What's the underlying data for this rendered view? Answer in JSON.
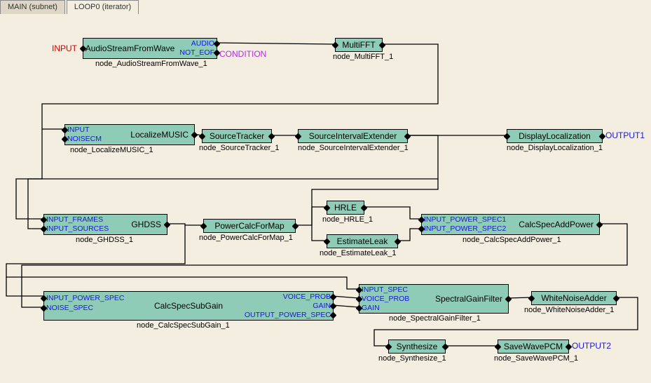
{
  "tabs": [
    {
      "label": "MAIN (subnet)"
    },
    {
      "label": "LOOP0 (iterator)",
      "active": true
    }
  ],
  "tags": {
    "input": "INPUT",
    "condition": "CONDITION",
    "output1": "OUTPUT1",
    "output2": "OUTPUT2"
  },
  "nodes": {
    "audio": {
      "title": "AudioStreamFromWave",
      "inst": "node_AudioStreamFromWave_1",
      "out1": "AUDIO",
      "out2": "NOT_EOF"
    },
    "mfft": {
      "title": "MultiFFT",
      "inst": "node_MultiFFT_1"
    },
    "loc": {
      "title": "LocalizeMUSIC",
      "inst": "node_LocalizeMUSIC_1",
      "in1": "INPUT",
      "in2": "NOISECM"
    },
    "trk": {
      "title": "SourceTracker",
      "inst": "node_SourceTracker_1"
    },
    "sie": {
      "title": "SourceIntervalExtender",
      "inst": "node_SourceIntervalExtender_1"
    },
    "disp": {
      "title": "DisplayLocalization",
      "inst": "node_DisplayLocalization_1"
    },
    "ghdss": {
      "title": "GHDSS",
      "inst": "node_GHDSS_1",
      "in1": "INPUT_FRAMES",
      "in2": "INPUT_SOURCES"
    },
    "pmap": {
      "title": "PowerCalcForMap",
      "inst": "node_PowerCalcForMap_1"
    },
    "hrle": {
      "title": "HRLE",
      "inst": "node_HRLE_1"
    },
    "eleak": {
      "title": "EstimateLeak",
      "inst": "node_EstimateLeak_1"
    },
    "csap": {
      "title": "CalcSpecAddPower",
      "inst": "node_CalcSpecAddPower_1",
      "in1": "INPUT_POWER_SPEC1",
      "in2": "INPUT_POWER_SPEC2"
    },
    "cssg": {
      "title": "CalcSpecSubGain",
      "inst": "node_CalcSpecSubGain_1",
      "in1": "INPUT_POWER_SPEC",
      "in2": "NOISE_SPEC",
      "out1": "VOICE_PROB",
      "out2": "GAIN",
      "out3": "OUTPUT_POWER_SPEC"
    },
    "sgf": {
      "title": "SpectralGainFilter",
      "inst": "node_SpectralGainFilter_1",
      "in1": "INPUT_SPEC",
      "in2": "VOICE_PROB",
      "in3": "GAIN"
    },
    "wna": {
      "title": "WhiteNoiseAdder",
      "inst": "node_WhiteNoiseAdder_1"
    },
    "syn": {
      "title": "Synthesize",
      "inst": "node_Synthesize_1"
    },
    "swp": {
      "title": "SaveWavePCM",
      "inst": "node_SaveWavePCM_1"
    }
  }
}
